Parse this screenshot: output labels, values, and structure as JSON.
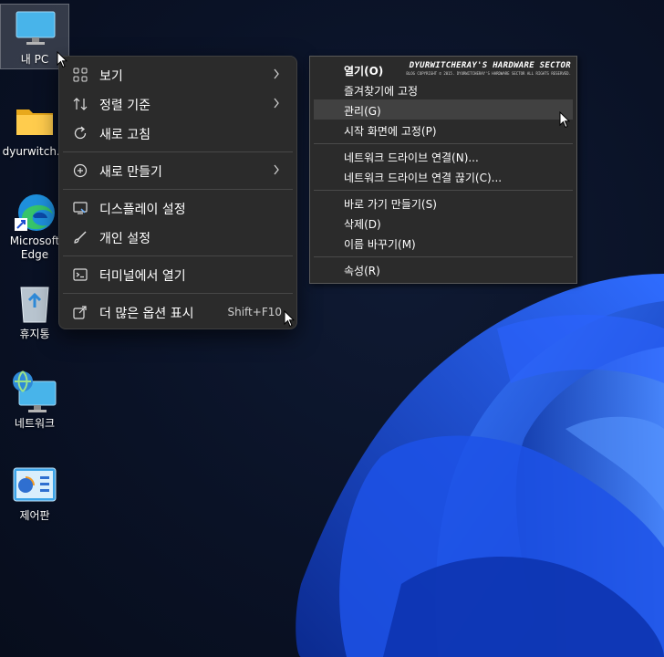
{
  "desktop": {
    "icons": [
      {
        "label": "내 PC",
        "icon": "this-pc-monitor-icon"
      },
      {
        "label": "dyurwitch...",
        "icon": "folder-icon"
      },
      {
        "label": "Microsoft Edge",
        "icon": "edge-icon"
      },
      {
        "label": "휴지통",
        "icon": "recycle-bin-icon"
      },
      {
        "label": "네트워크",
        "icon": "network-icon"
      },
      {
        "label": "제어판",
        "icon": "control-panel-icon"
      }
    ]
  },
  "context_menu": {
    "items": [
      {
        "label": "보기",
        "icon": "grid-icon",
        "submenu": true
      },
      {
        "label": "정렬 기준",
        "icon": "sort-icon",
        "submenu": true
      },
      {
        "label": "새로 고침",
        "icon": "refresh-icon"
      },
      {
        "label": "새로 만들기",
        "icon": "plus-circle-icon",
        "submenu": true
      },
      {
        "label": "디스플레이 설정",
        "icon": "display-icon"
      },
      {
        "label": "개인 설정",
        "icon": "brush-icon"
      },
      {
        "label": "터미널에서 열기",
        "icon": "terminal-icon"
      },
      {
        "label": "더 많은 옵션 표시",
        "icon": "open-external-icon",
        "shortcut": "Shift+F10"
      }
    ]
  },
  "classic_menu": {
    "watermark": {
      "title": "DYURWITCHERAY'S HARDWARE SECTOR",
      "subtitle": "BLOG COPYRIGHT © 2015. DYURWITCHERAY'S HARDWARE SECTOR ALL RIGHTS RESERVED."
    },
    "items": [
      {
        "label": "열기(O)",
        "bold": true
      },
      {
        "label": "즐겨찾기에 고정"
      },
      {
        "label": "관리(G)",
        "hover": true
      },
      {
        "label": "시작 화면에 고정(P)"
      },
      {
        "label": "네트워크 드라이브 연결(N)..."
      },
      {
        "label": "네트워크 드라이브 연결 끊기(C)..."
      },
      {
        "label": "바로 가기 만들기(S)"
      },
      {
        "label": "삭제(D)"
      },
      {
        "label": "이름 바꾸기(M)"
      },
      {
        "label": "속성(R)"
      }
    ]
  },
  "colors": {
    "menu_bg": "#2b2b2b",
    "hover_bg": "#414141",
    "wallpaper_blue": "#1f5fff"
  }
}
